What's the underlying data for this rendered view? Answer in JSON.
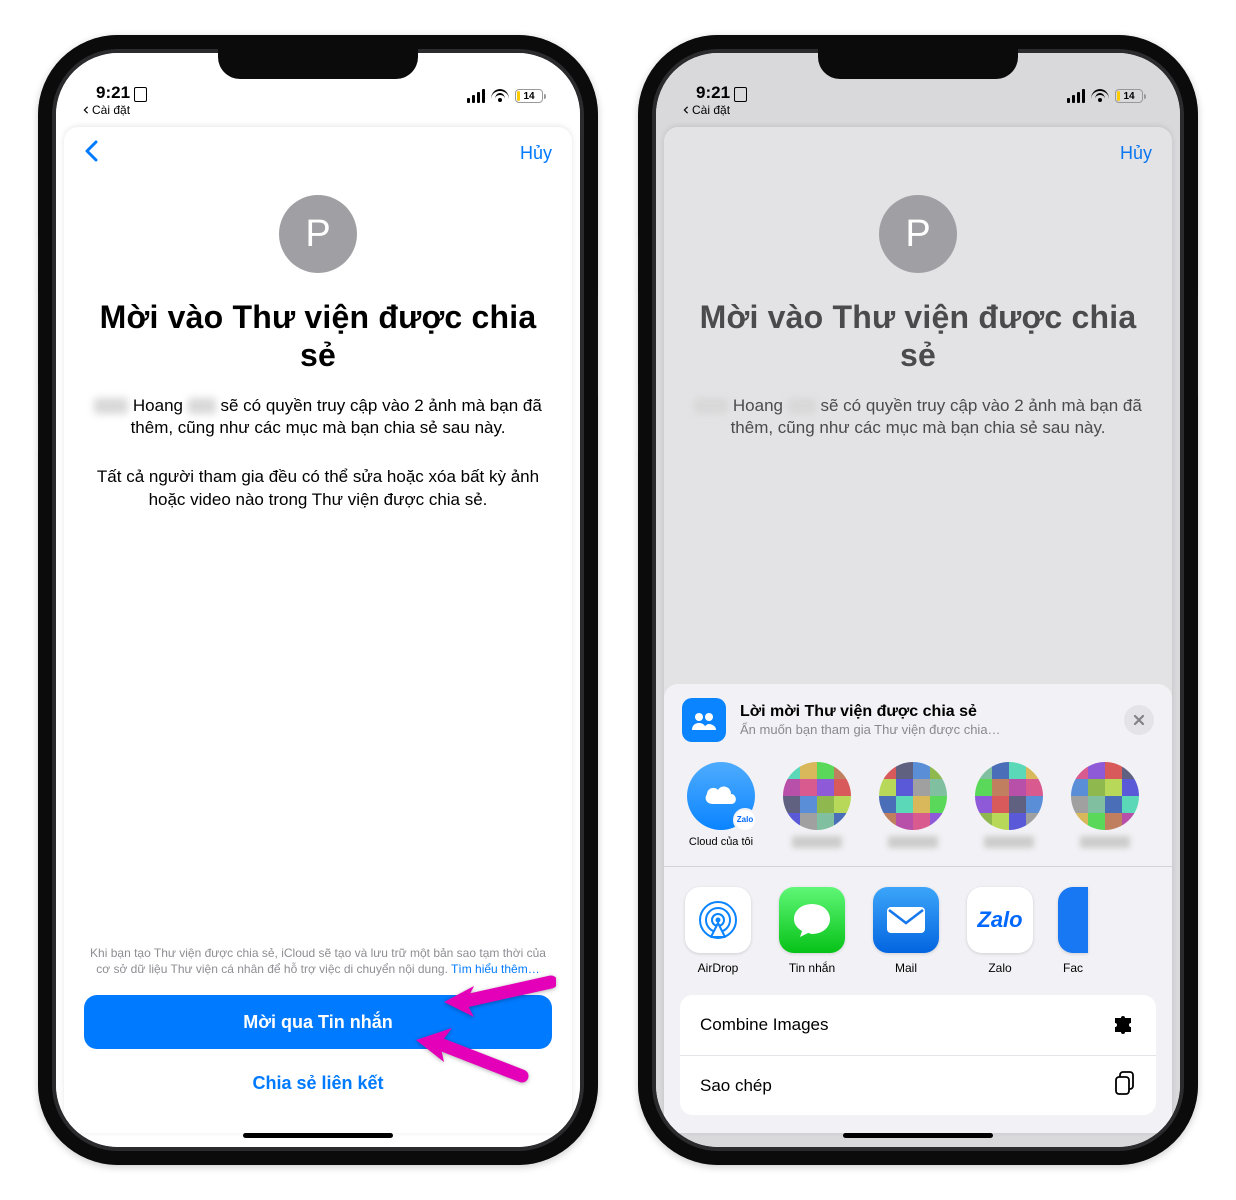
{
  "status": {
    "time": "9:21",
    "breadcrumb": "Cài đặt",
    "battery": "14"
  },
  "nav": {
    "cancel": "Hủy"
  },
  "avatar_initial": "P",
  "title": "Mời vào Thư viện được chia sẻ",
  "desc_name": "Hoang",
  "desc_rest1": "sẽ có quyền truy cập vào 2 ảnh mà bạn đã thêm, cũng như các mục mà bạn chia sẻ sau này.",
  "desc2": "Tất cả người tham gia đều có thể sửa hoặc xóa bất kỳ ảnh hoặc video nào trong Thư viện được chia sẻ.",
  "desc_partial": "sẽ có quyền truy cập vào 2 ảnh mà bạn đã thêm, cũng như các mục mà bạn chia sẻ sau này.",
  "fine_text": "Khi bạn tạo Thư viện được chia sẻ, iCloud sẽ tạo và lưu trữ một bản sao tạm thời của cơ sở dữ liệu Thư viện cá nhân để hỗ trợ việc di chuyển nội dung. ",
  "fine_link": "Tìm hiểu thêm…",
  "btn_primary": "Mời qua Tin nhắn",
  "btn_link": "Chia sẻ liên kết",
  "share": {
    "title": "Lời mời Thư viện được chia sẻ",
    "subtitle": "Ẩn muốn bạn tham gia Thư viện được chia…",
    "contacts": [
      {
        "label": "Cloud của tôi",
        "type": "cloud",
        "badge": "Zalo"
      },
      {
        "type": "pix"
      },
      {
        "type": "pix"
      },
      {
        "type": "pix"
      },
      {
        "type": "pix"
      }
    ],
    "apps": [
      {
        "label": "AirDrop",
        "kind": "airdrop"
      },
      {
        "label": "Tin nhắn",
        "kind": "messages"
      },
      {
        "label": "Mail",
        "kind": "mail"
      },
      {
        "label": "Zalo",
        "kind": "zalo"
      },
      {
        "label": "Fac",
        "kind": "facebook"
      }
    ],
    "actions": [
      {
        "label": "Combine Images",
        "icon": "puzzle"
      },
      {
        "label": "Sao chép",
        "icon": "copy"
      }
    ]
  }
}
